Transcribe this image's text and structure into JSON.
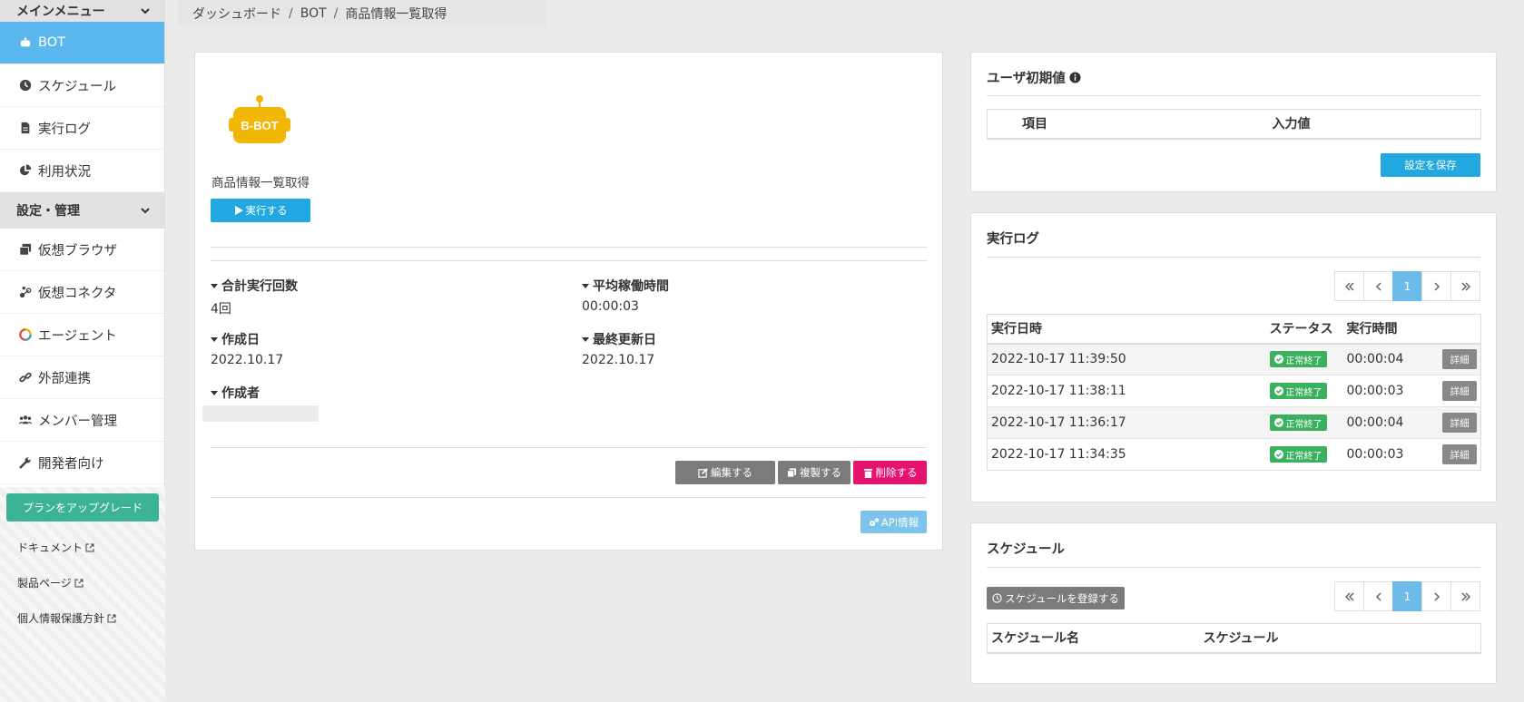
{
  "sidebar": {
    "main_menu_label": "メインメニュー",
    "items": [
      {
        "label": "BOT",
        "icon": "robot-icon"
      },
      {
        "label": "スケジュール",
        "icon": "clock-icon"
      },
      {
        "label": "実行ログ",
        "icon": "file-icon"
      },
      {
        "label": "利用状況",
        "icon": "pie-chart-icon"
      }
    ],
    "settings_label": "設定・管理",
    "settings_items": [
      {
        "label": "仮想ブラウザ",
        "icon": "browser-icon"
      },
      {
        "label": "仮想コネクタ",
        "icon": "connector-icon"
      },
      {
        "label": "エージェント",
        "icon": "agent-icon"
      },
      {
        "label": "外部連携",
        "icon": "link-icon"
      },
      {
        "label": "メンバー管理",
        "icon": "users-icon"
      },
      {
        "label": "開発者向け",
        "icon": "wrench-icon"
      }
    ],
    "upgrade_label": "プランをアップグレード",
    "links": [
      "ドキュメント",
      "製品ページ",
      "個人情報保護方針"
    ]
  },
  "breadcrumb": [
    "ダッシュボード",
    "BOT",
    "商品情報一覧取得"
  ],
  "bot": {
    "logo_text": "B-BOT",
    "name": "商品情報一覧取得",
    "run_label": "実行する",
    "stats": {
      "total_runs_label": "合計実行回数",
      "total_runs_value": "4回",
      "avg_time_label": "平均稼働時間",
      "avg_time_value": "00:00:03",
      "created_label": "作成日",
      "created_value": "2022.10.17",
      "updated_label": "最終更新日",
      "updated_value": "2022.10.17",
      "author_label": "作成者"
    },
    "edit_label": "編集する",
    "copy_label": "複製する",
    "delete_label": "削除する",
    "api_label": "API情報"
  },
  "user_defaults": {
    "title": "ユーザ初期値",
    "col_item": "項目",
    "col_value": "入力値",
    "save_label": "設定を保存"
  },
  "exec_log": {
    "title": "実行ログ",
    "page": "1",
    "headers": [
      "実行日時",
      "ステータス",
      "実行時間"
    ],
    "rows": [
      {
        "date": "2022-10-17 11:39:50",
        "status": "正常終了",
        "time": "00:00:04",
        "detail": "詳細"
      },
      {
        "date": "2022-10-17 11:38:11",
        "status": "正常終了",
        "time": "00:00:03",
        "detail": "詳細"
      },
      {
        "date": "2022-10-17 11:36:17",
        "status": "正常終了",
        "time": "00:00:04",
        "detail": "詳細"
      },
      {
        "date": "2022-10-17 11:34:35",
        "status": "正常終了",
        "time": "00:00:03",
        "detail": "詳細"
      }
    ]
  },
  "schedule": {
    "title": "スケジュール",
    "register_label": "スケジュールを登録する",
    "page": "1",
    "headers": [
      "スケジュール名",
      "スケジュール"
    ]
  },
  "colors": {
    "accent": "#5bb8ee",
    "primary_button": "#22a8e0",
    "success": "#3bb05e",
    "danger": "#e5126e",
    "upgrade": "#3cb394"
  }
}
